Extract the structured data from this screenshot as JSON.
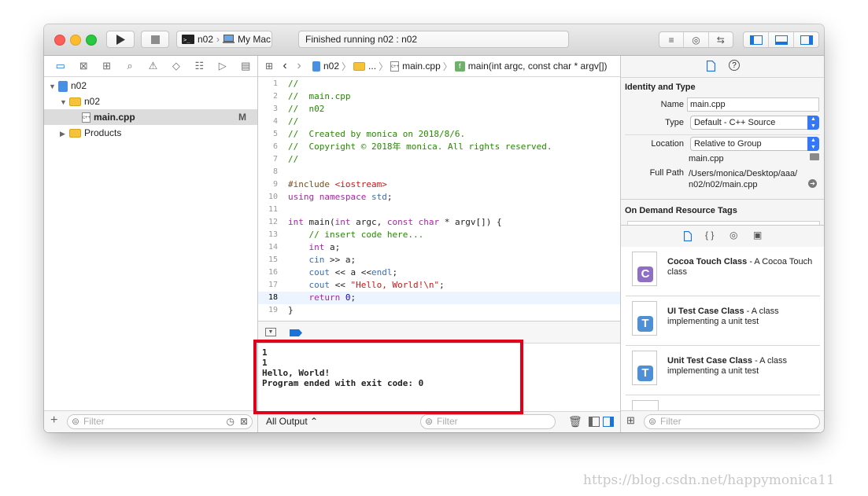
{
  "toolbar": {
    "scheme_target": "n02",
    "scheme_device": "My Mac",
    "status": "Finished running n02 : n02"
  },
  "navigator": {
    "tree": [
      {
        "label": "n02",
        "kind": "project"
      },
      {
        "label": "n02",
        "kind": "group"
      },
      {
        "label": "main.cpp",
        "kind": "file",
        "badge": "M"
      },
      {
        "label": "Products",
        "kind": "group"
      }
    ],
    "filter_placeholder": "Filter"
  },
  "editor": {
    "jumpbar": [
      "n02",
      "...",
      "main.cpp",
      "main(int argc, const char * argv[])"
    ],
    "current_line": 18,
    "lines": [
      {
        "n": "1",
        "html": "<span class=\"c-com\">//</span>"
      },
      {
        "n": "2",
        "html": "<span class=\"c-com\">//  main.cpp</span>"
      },
      {
        "n": "3",
        "html": "<span class=\"c-com\">//  n02</span>"
      },
      {
        "n": "4",
        "html": "<span class=\"c-com\">//</span>"
      },
      {
        "n": "5",
        "html": "<span class=\"c-com\">//  Created by monica on 2018/8/6.</span>"
      },
      {
        "n": "6",
        "html": "<span class=\"c-com\">//  Copyright © 2018年 monica. All rights reserved.</span>"
      },
      {
        "n": "7",
        "html": "<span class=\"c-com\">//</span>"
      },
      {
        "n": "8",
        "html": ""
      },
      {
        "n": "9",
        "html": "<span class=\"c-pre\">#include </span><span class=\"c-str\">&lt;iostream&gt;</span>"
      },
      {
        "n": "10",
        "html": "<span class=\"c-kw\">using namespace</span> <span class=\"c-id\">std</span>;"
      },
      {
        "n": "11",
        "html": ""
      },
      {
        "n": "12",
        "html": "<span class=\"c-kw\">int</span> main(<span class=\"c-kw\">int</span> argc, <span class=\"c-kw\">const char</span> * argv[]) {"
      },
      {
        "n": "13",
        "html": "    <span class=\"c-com\">// insert code here...</span>"
      },
      {
        "n": "14",
        "html": "    <span class=\"c-kw\">int</span> a;"
      },
      {
        "n": "15",
        "html": "    <span class=\"c-id\">cin</span> &gt;&gt; a;"
      },
      {
        "n": "16",
        "html": "    <span class=\"c-id\">cout</span> &lt;&lt; a &lt;&lt;<span class=\"c-id\">endl</span>;"
      },
      {
        "n": "17",
        "html": "    <span class=\"c-id\">cout</span> &lt;&lt; <span class=\"c-str\">\"Hello, World!\\n\"</span>;"
      },
      {
        "n": "18",
        "html": "    <span class=\"c-kw\">return</span> <span class=\"c-num\">0</span>;"
      },
      {
        "n": "19",
        "html": "}"
      }
    ]
  },
  "console": {
    "lines": [
      "1",
      "1",
      "Hello, World!",
      "Program ended with exit code: 0"
    ],
    "output_selector": "All Output",
    "filter_placeholder": "Filter"
  },
  "inspector": {
    "identity_title": "Identity and Type",
    "name_label": "Name",
    "name_value": "main.cpp",
    "type_label": "Type",
    "type_value": "Default - C++ Source",
    "location_label": "Location",
    "location_value": "Relative to Group",
    "location_file": "main.cpp",
    "fullpath_label": "Full Path",
    "fullpath_value1": "/Users/monica/Desktop/aaa/",
    "fullpath_value2": "n02/n02/main.cpp",
    "odr_title": "On Demand Resource Tags",
    "templates": [
      {
        "letter": "C",
        "color": "#8e6fc4",
        "title": "Cocoa Touch Class",
        "desc": " - A Cocoa Touch class"
      },
      {
        "letter": "T",
        "color": "#4f8fd6",
        "title": "UI Test Case Class",
        "desc": " - A class implementing a unit test"
      },
      {
        "letter": "T",
        "color": "#4f8fd6",
        "title": "Unit Test Case Class",
        "desc": " - A class implementing a unit test"
      }
    ],
    "filter_placeholder": "Filter"
  },
  "watermark": "https://blog.csdn.net/happymonica11"
}
